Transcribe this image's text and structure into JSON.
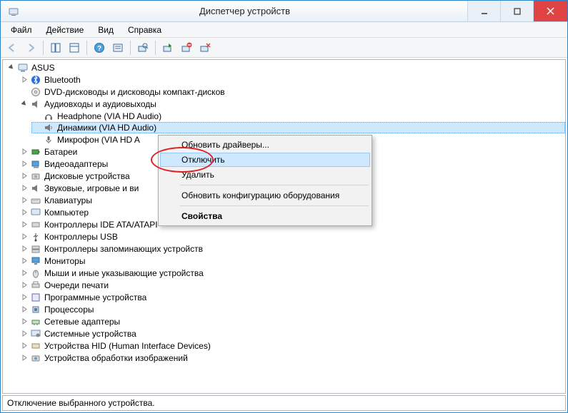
{
  "window": {
    "title": "Диспетчер устройств"
  },
  "menu": {
    "file": "Файл",
    "action": "Действие",
    "view": "Вид",
    "help": "Справка"
  },
  "tree": {
    "root": "ASUS",
    "bluetooth": "Bluetooth",
    "dvd": "DVD-дисководы и дисководы компакт-дисков",
    "audio": "Аудиовходы и аудиовыходы",
    "audio_headphone": "Headphone (VIA HD Audio)",
    "audio_speakers": "Динамики (VIA HD Audio)",
    "audio_mic": "Микрофон (VIA HD A",
    "battery": "Батареи",
    "video": "Видеоадаптеры",
    "disk": "Дисковые устройства",
    "sound": "Звуковые, игровые и ви",
    "keyboard": "Клавиатуры",
    "computer": "Компьютер",
    "ide": "Контроллеры IDE ATA/ATAPI",
    "usb": "Контроллеры USB",
    "storage": "Контроллеры запоминающих устройств",
    "monitor": "Мониторы",
    "mouse": "Мыши и иные указывающие устройства",
    "print": "Очереди печати",
    "software": "Программные устройства",
    "cpu": "Процессоры",
    "net": "Сетевые адаптеры",
    "system": "Системные устройства",
    "hid": "Устройства HID (Human Interface Devices)",
    "imaging": "Устройства обработки изображений"
  },
  "context_menu": {
    "update_drivers": "Обновить драйверы...",
    "disable": "Отключить",
    "delete": "Удалить",
    "scan": "Обновить конфигурацию оборудования",
    "properties": "Свойства"
  },
  "status": "Отключение выбранного устройства."
}
